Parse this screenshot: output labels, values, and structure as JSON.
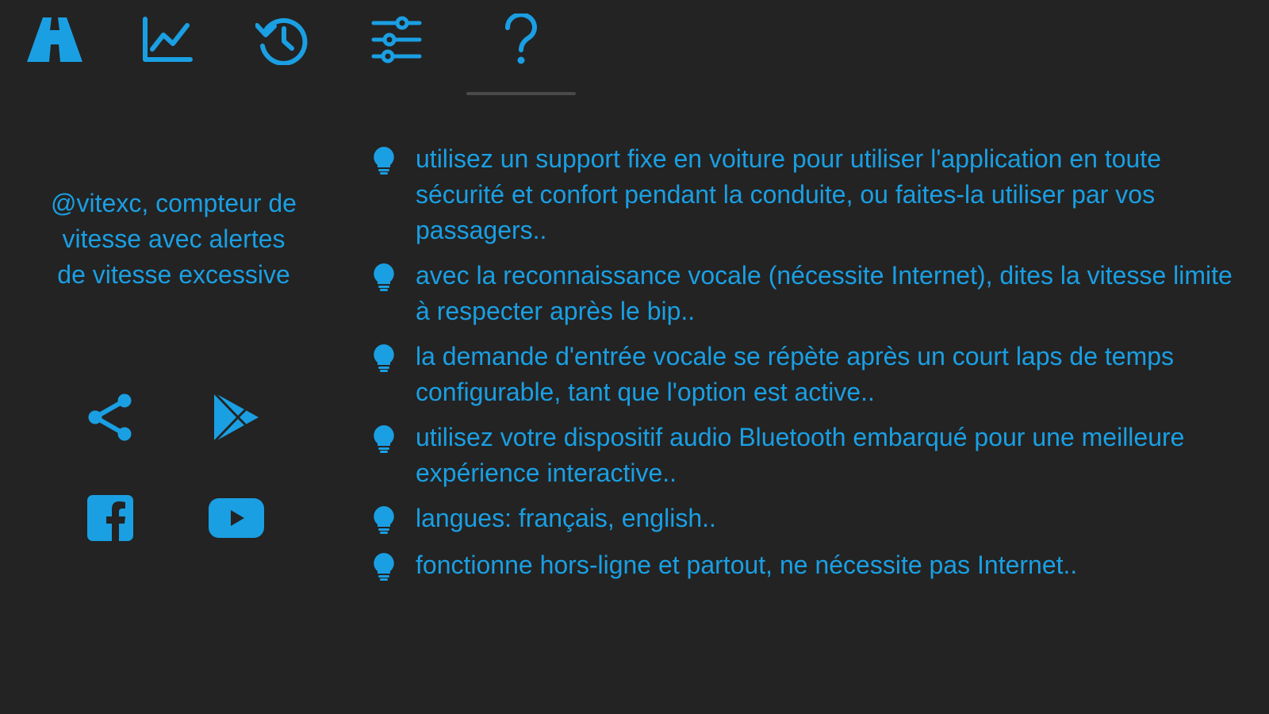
{
  "colors": {
    "background": "#232323",
    "accent": "#1a9fe3",
    "indicator": "#4a4a4a"
  },
  "tabs": [
    {
      "id": "speedometer",
      "icon": "road-icon"
    },
    {
      "id": "chart",
      "icon": "line-chart-icon"
    },
    {
      "id": "history",
      "icon": "history-icon"
    },
    {
      "id": "settings",
      "icon": "sliders-icon"
    },
    {
      "id": "help",
      "icon": "question-icon",
      "active": true
    }
  ],
  "app": {
    "title": "@vitexc, compteur de vitesse avec alertes de vitesse excessive"
  },
  "social": [
    {
      "id": "share",
      "icon": "share-icon"
    },
    {
      "id": "play-store",
      "icon": "play-store-icon"
    },
    {
      "id": "facebook",
      "icon": "facebook-icon"
    },
    {
      "id": "youtube",
      "icon": "youtube-icon"
    }
  ],
  "tips": [
    {
      "icon": "lightbulb-icon",
      "text": "utilisez un support fixe en voiture pour utiliser l'application en toute sécurité et confort pendant la conduite, ou faites-la utiliser par vos passagers.."
    },
    {
      "icon": "lightbulb-icon",
      "text": "avec la reconnaissance vocale (nécessite Internet), dites la vitesse limite à respecter après le bip.."
    },
    {
      "icon": "lightbulb-icon",
      "text": "la demande d'entrée vocale se répète après un court laps de temps configurable, tant que l'option est active.."
    },
    {
      "icon": "lightbulb-icon",
      "text": "utilisez votre dispositif audio Bluetooth embarqué pour une meilleure expérience interactive.."
    },
    {
      "icon": "lightbulb-icon",
      "text": "langues: français, english.."
    },
    {
      "icon": "lightbulb-icon",
      "text": "fonctionne hors-ligne et partout, ne nécessite pas Internet.."
    }
  ]
}
